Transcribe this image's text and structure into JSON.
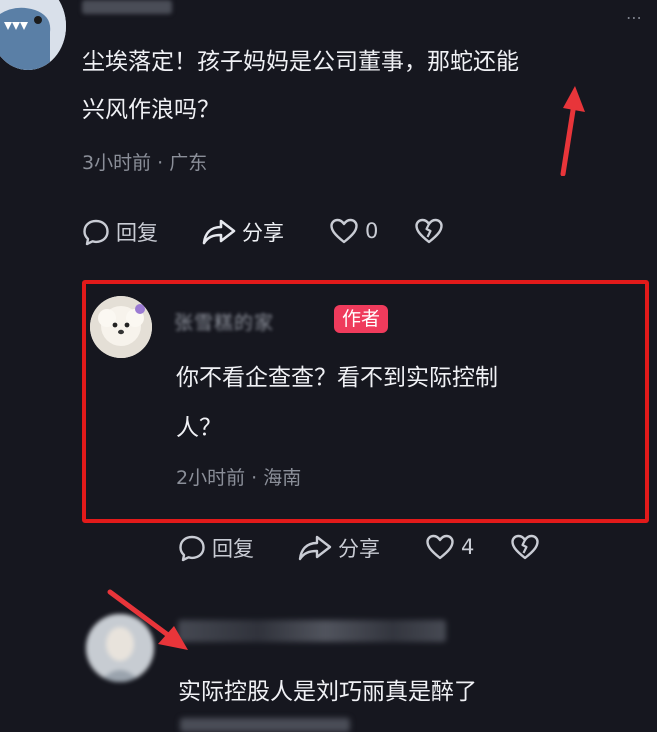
{
  "colors": {
    "background": "#16171f",
    "text": "#f0f1f5",
    "meta": "#8b8f99",
    "author_badge": "#ef3b5c",
    "highlight": "#e21a1a"
  },
  "comment1": {
    "text_line1": "尘埃落定！孩子妈妈是公司董事，那蛇还能",
    "text_line2": "兴风作浪吗？",
    "meta": "3小时前 · 广东",
    "reply_label": "回复",
    "share_label": "分享",
    "like_count": "0"
  },
  "reply": {
    "username": "张雪糕的家",
    "badge": "作者",
    "text_line1": "你不看企查查？看不到实际控制",
    "text_line2": "人？",
    "meta": "2小时前 · 海南",
    "reply_label": "回复",
    "share_label": "分享",
    "like_count": "4"
  },
  "comment2": {
    "text_line1": "实际控股人是刘巧丽真是醉了"
  }
}
